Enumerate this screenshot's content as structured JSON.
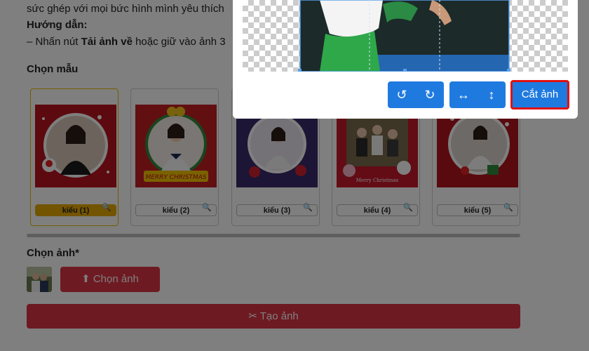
{
  "intro": {
    "line1": "sức ghép với mọi bức hình mình yêu thích",
    "guide_title": "Hướng dẫn:",
    "step_prefix": "– Nhấn nút ",
    "step_bold": "Tải ảnh về",
    "step_suffix": " hoặc giữ vào ảnh 3"
  },
  "templates": {
    "title": "Chọn mẫu",
    "items": [
      {
        "label": "kiểu (1)",
        "selected": true
      },
      {
        "label": "kiểu (2)",
        "selected": false
      },
      {
        "label": "kiểu (3)",
        "selected": false
      },
      {
        "label": "kiểu (4)",
        "selected": false
      },
      {
        "label": "kiểu (5)",
        "selected": false
      }
    ],
    "thumb2_banner": "MERRY CHRISTMAS",
    "thumb4_banner": "Merry Christmas"
  },
  "photo": {
    "title": "Chọn ảnh*",
    "choose_label": "Chọn ảnh",
    "create_label": "Tạo ảnh"
  },
  "modal": {
    "crop_label": "Cắt ảnh"
  },
  "colors": {
    "primary": "#1f7ae0",
    "danger": "#dc3545",
    "highlight": "#e01010",
    "selected": "#e6a800"
  },
  "icons": [
    "rotate-left-icon",
    "rotate-right-icon",
    "flip-horizontal-icon",
    "flip-vertical-icon",
    "search-icon",
    "upload-icon",
    "scissors-icon"
  ]
}
